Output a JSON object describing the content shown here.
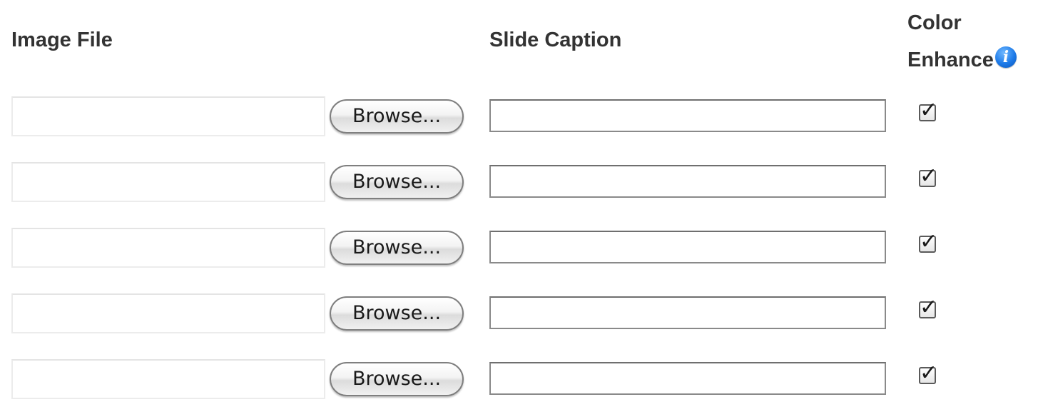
{
  "headers": {
    "image_file": "Image File",
    "slide_caption": "Slide Caption",
    "color_enhance_line1": "Color",
    "color_enhance_line2": "Enhance",
    "info_icon_glyph": "i"
  },
  "rows": [
    {
      "file_path": "",
      "browse_label": "Browse...",
      "caption": "",
      "color_enhance_checked": true
    },
    {
      "file_path": "",
      "browse_label": "Browse...",
      "caption": "",
      "color_enhance_checked": true
    },
    {
      "file_path": "",
      "browse_label": "Browse...",
      "caption": "",
      "color_enhance_checked": true
    },
    {
      "file_path": "",
      "browse_label": "Browse...",
      "caption": "",
      "color_enhance_checked": true
    },
    {
      "file_path": "",
      "browse_label": "Browse...",
      "caption": "",
      "color_enhance_checked": true
    }
  ],
  "icons": {
    "info": "info-icon",
    "check": "checkmark-icon"
  },
  "colors": {
    "info_icon": "#1d7ae8",
    "header_text": "#333333"
  }
}
